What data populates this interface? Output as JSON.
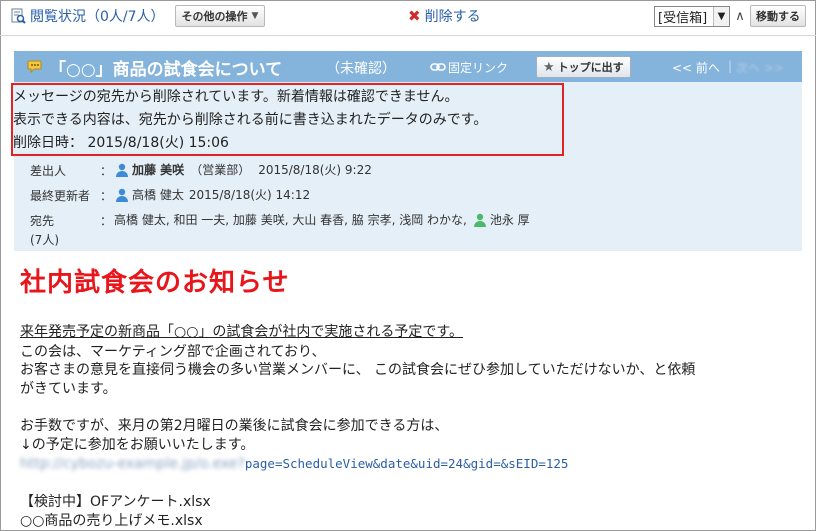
{
  "toolbar": {
    "read_status": "閲覧状況（0人/7人）",
    "other_ops": "その他の操作",
    "delete": "削除する",
    "folder_selected": "[受信箱]",
    "move": "移動する"
  },
  "message": {
    "title": "「○○」商品の試食会について",
    "status": "（未確認）",
    "fixed_link": "固定リンク",
    "top_button": "トップに出す",
    "prev": "<< 前へ",
    "next": "次へ >>",
    "notice": {
      "line1": "メッセージの宛先から削除されています。新着情報は確認できません。",
      "line2": "表示できる内容は、宛先から削除される前に書き込まれたデータのみです。",
      "line3": "削除日時： 2015/8/18(火) 15:06"
    },
    "meta": {
      "sender_label": "差出人",
      "sender_name": "加藤 美咲",
      "sender_dept": "（営業部）",
      "sender_date": "2015/8/18(火) 9:22",
      "updater_label": "最終更新者",
      "updater_name": "高橋 健太",
      "updater_date": "2015/8/18(火) 14:12",
      "to_label": "宛先",
      "to_names": "高橋 健太, 和田 一夫, 加藤 美咲, 大山 春香, 脇 宗孝, 浅岡 わかな,",
      "to_last": "池永 厚",
      "to_count": "(7人)",
      "colon": "："
    }
  },
  "body": {
    "heading": "社内試食会のお知らせ",
    "p1": "来年発売予定の新商品「○○」の試食会が社内で実施される予定です。",
    "p2": "この会は、マーケティング部で企画されており、",
    "p3a": "お客さまの意見を直接伺う機会の多い営業メンバーに、 この試食会にぜひ参加していただけないか、と依頼",
    "p3b": "がきています。",
    "p4": "お手数ですが、来月の第2月曜日の業後に試食会に参加できる方は、",
    "p5": "↓の予定に参加をお願いいたします。",
    "url_hidden": "http://cybozu-example.jp/o.exe?",
    "url_tail": "page=ScheduleView&date&uid=24&gid=&sEID=125",
    "file1": "【検討中】OFアンケート.xlsx",
    "file2": "○○商品の売り上げメモ.xlsx"
  }
}
